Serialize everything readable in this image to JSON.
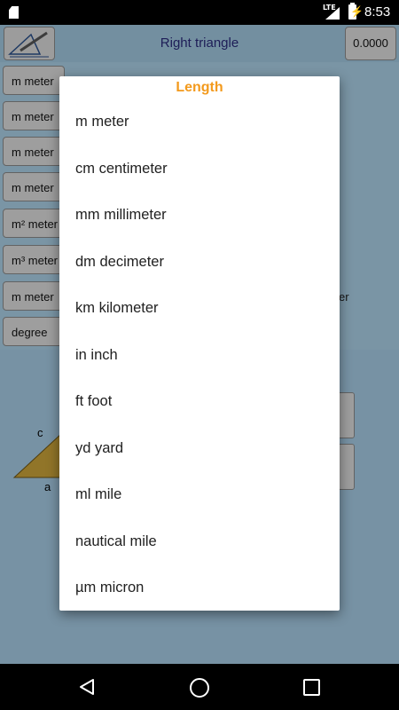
{
  "status_bar": {
    "network": "LTE",
    "time": "8:53"
  },
  "app": {
    "title": "Right triangle",
    "result": "0.0000",
    "unit_buttons": [
      "m meter",
      "m meter",
      "m meter",
      "m meter",
      "m² meter",
      "m³ meter",
      "m meter",
      "degree"
    ],
    "background_fragment": "er",
    "triangle_labels": {
      "c": "c",
      "a": "a"
    }
  },
  "dialog": {
    "title": "Length",
    "items": [
      "m meter",
      "cm centimeter",
      "mm millimeter",
      "dm decimeter",
      "km kilometer",
      "in inch",
      "ft foot",
      "yd yard",
      "ml mile",
      "nautical mile",
      "µm micron"
    ]
  },
  "colors": {
    "dialog_title": "#f39a1d",
    "app_title": "#2a2a7a",
    "app_background": "#aacfe5"
  },
  "icons": {
    "back": "back-triangle-icon",
    "home": "home-circle-icon",
    "recent": "recent-square-icon"
  }
}
